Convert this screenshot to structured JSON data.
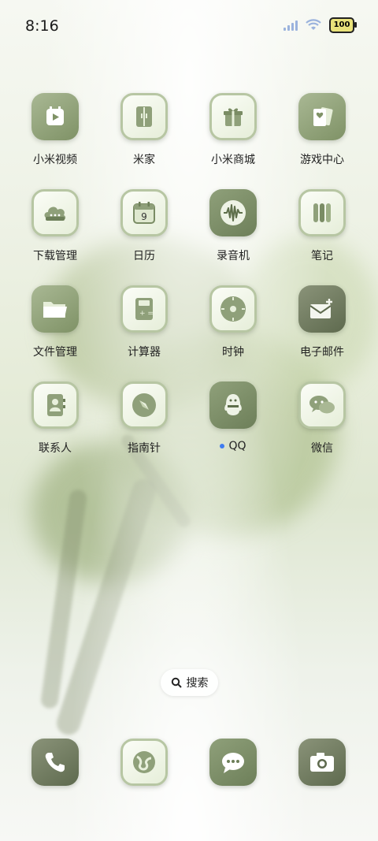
{
  "status_bar": {
    "time": "8:16",
    "battery": "100"
  },
  "apps": [
    {
      "label": "小米视频",
      "icon": "video-icon"
    },
    {
      "label": "米家",
      "icon": "mijia-icon"
    },
    {
      "label": "小米商城",
      "icon": "gift-icon"
    },
    {
      "label": "游戏中心",
      "icon": "cards-icon"
    },
    {
      "label": "下载管理",
      "icon": "cloud-download-icon"
    },
    {
      "label": "日历",
      "icon": "calendar-icon",
      "day": "9"
    },
    {
      "label": "录音机",
      "icon": "waveform-icon"
    },
    {
      "label": "笔记",
      "icon": "notes-icon"
    },
    {
      "label": "文件管理",
      "icon": "folder-icon"
    },
    {
      "label": "计算器",
      "icon": "calculator-icon"
    },
    {
      "label": "时钟",
      "icon": "clock-icon"
    },
    {
      "label": "电子邮件",
      "icon": "mail-icon"
    },
    {
      "label": "联系人",
      "icon": "contacts-icon"
    },
    {
      "label": "指南针",
      "icon": "compass-icon"
    },
    {
      "label": "QQ",
      "icon": "qq-icon"
    },
    {
      "label": "微信",
      "icon": "wechat-icon"
    }
  ],
  "search": {
    "label": "搜索"
  },
  "dock": [
    {
      "name": "phone-icon"
    },
    {
      "name": "browser-icon"
    },
    {
      "name": "messages-icon"
    },
    {
      "name": "camera-icon"
    }
  ]
}
